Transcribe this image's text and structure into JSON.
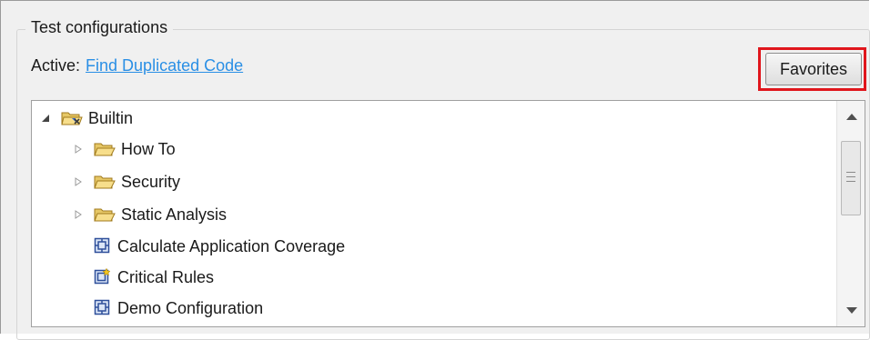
{
  "group": {
    "title": "Test configurations"
  },
  "active": {
    "label": "Active:",
    "link": "Find Duplicated Code"
  },
  "favorites_button": {
    "label": "Favorites"
  },
  "colors": {
    "link": "#2a8fe5",
    "highlight": "#e0161c"
  },
  "tree": {
    "root": {
      "label": "Builtin",
      "expanded": true,
      "icon": "builtin-folder-icon"
    },
    "folders": [
      {
        "label": "How To",
        "icon": "folder-open-icon"
      },
      {
        "label": "Security",
        "icon": "folder-open-icon"
      },
      {
        "label": "Static Analysis",
        "icon": "folder-open-icon"
      }
    ],
    "configs": [
      {
        "label": "Calculate Application Coverage",
        "icon": "config-icon"
      },
      {
        "label": "Critical Rules",
        "icon": "config-star-icon"
      },
      {
        "label": "Demo Configuration",
        "icon": "config-icon"
      }
    ]
  }
}
